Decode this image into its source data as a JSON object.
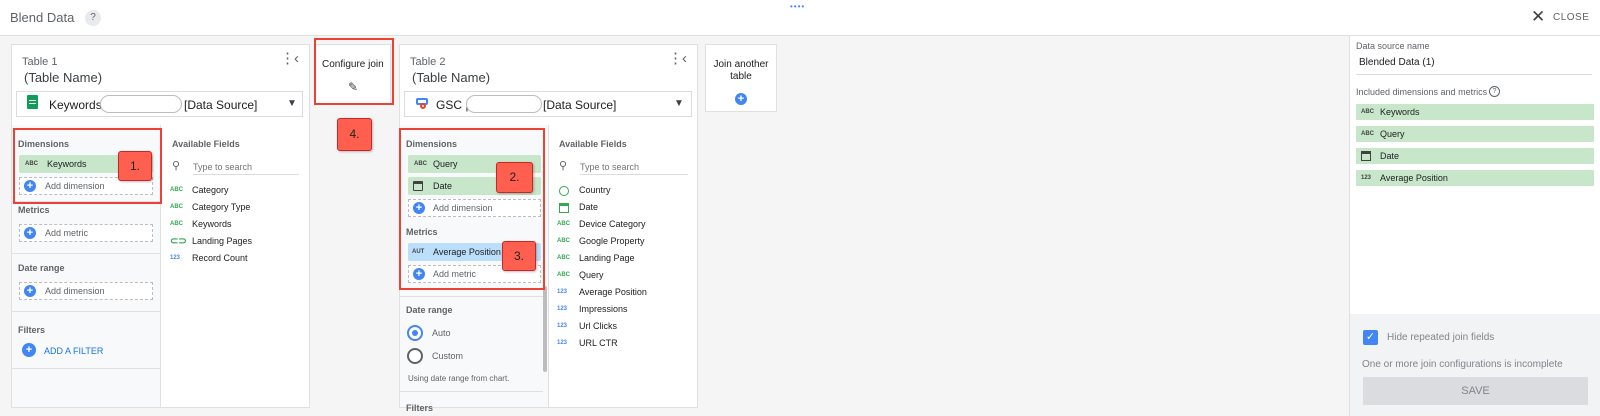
{
  "app": {
    "title": "Blend Data",
    "help": "?",
    "close_label": "CLOSE",
    "drag_handle": "••••"
  },
  "table1": {
    "label": "Table 1",
    "name": "(Table Name)",
    "source_prefix": "Keywords",
    "source_suffix": "[Data Source]",
    "dimensions_title": "Dimensions",
    "dimensions": [
      {
        "type": "ABC",
        "label": "Keywords"
      }
    ],
    "add_dimension": "Add dimension",
    "metrics_title": "Metrics",
    "add_metric": "Add metric",
    "date_range_title": "Date range",
    "date_range_add": "Add dimension",
    "filters_title": "Filters",
    "add_filter": "ADD A FILTER",
    "available_title": "Available Fields",
    "search_placeholder": "Type to search",
    "fields": [
      {
        "type": "ABC",
        "label": "Category"
      },
      {
        "type": "ABC",
        "label": "Category Type"
      },
      {
        "type": "ABC",
        "label": "Keywords"
      },
      {
        "type": "link",
        "label": "Landing Pages"
      },
      {
        "type": "123",
        "label": "Record Count"
      }
    ]
  },
  "configure_join": {
    "label": "Configure join"
  },
  "table2": {
    "label": "Table 2",
    "name": "(Table Name)",
    "source_prefix": "GSC |",
    "source_suffix": "[Data Source]",
    "dimensions_title": "Dimensions",
    "dimensions": [
      {
        "type": "ABC",
        "label": "Query"
      },
      {
        "type": "date",
        "label": "Date"
      }
    ],
    "add_dimension": "Add dimension",
    "metrics_title": "Metrics",
    "metrics": [
      {
        "type": "AUT",
        "label": "Average Position"
      }
    ],
    "add_metric": "Add metric",
    "date_range_title": "Date range",
    "date_options": [
      "Auto",
      "Custom"
    ],
    "date_note": "Using date range from chart.",
    "filters_partial": "Filters",
    "available_title": "Available Fields",
    "search_placeholder": "Type to search",
    "fields": [
      {
        "type": "geo",
        "label": "Country"
      },
      {
        "type": "date",
        "label": "Date"
      },
      {
        "type": "ABC",
        "label": "Device Category"
      },
      {
        "type": "ABC",
        "label": "Google Property"
      },
      {
        "type": "ABC",
        "label": "Landing Page"
      },
      {
        "type": "ABC",
        "label": "Query"
      },
      {
        "type": "123",
        "label": "Average Position"
      },
      {
        "type": "123",
        "label": "Impressions"
      },
      {
        "type": "123",
        "label": "Url Clicks"
      },
      {
        "type": "123",
        "label": "URL CTR"
      }
    ]
  },
  "join_another": {
    "label_line1": "Join another",
    "label_line2": "table"
  },
  "annotations": [
    "1.",
    "2.",
    "3.",
    "4."
  ],
  "right_panel": {
    "source_name_label": "Data source name",
    "source_name_value": "Blended Data (1)",
    "included_label": "Included dimensions and metrics",
    "included": [
      {
        "type": "ABC",
        "label": "Keywords"
      },
      {
        "type": "ABC",
        "label": "Query"
      },
      {
        "type": "date",
        "label": "Date"
      },
      {
        "type": "123",
        "label": "Average Position"
      }
    ],
    "hide_repeated_label": "Hide repeated join fields",
    "hide_repeated_checked": true,
    "warning": "One or more join configurations is incomplete",
    "save_label": "SAVE"
  }
}
